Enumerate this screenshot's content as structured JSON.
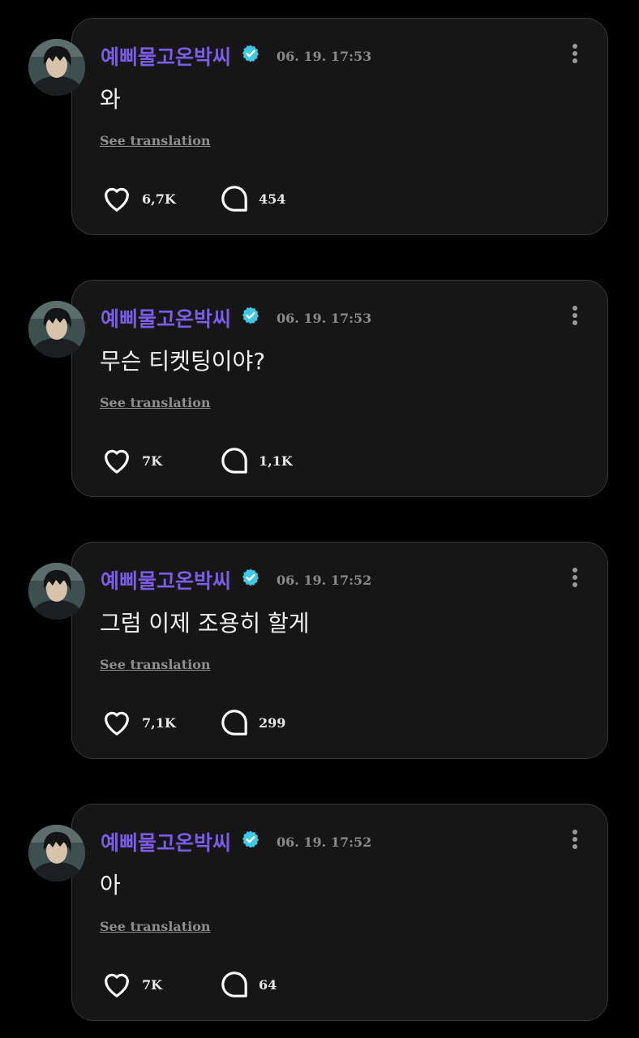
{
  "posts": [
    {
      "username": "예삐물고온박씨",
      "timestamp": "06. 19. 17:53",
      "message": "와",
      "translate_label": "See translation",
      "likes": "6,7K",
      "replies": "454"
    },
    {
      "username": "예삐물고온박씨",
      "timestamp": "06. 19. 17:53",
      "message": "무슨 티켓팅이야?",
      "translate_label": "See translation",
      "likes": "7K",
      "replies": "1,1K"
    },
    {
      "username": "예삐물고온박씨",
      "timestamp": "06. 19. 17:52",
      "message": "그럼 이제 조용히 할게",
      "translate_label": "See translation",
      "likes": "7,1K",
      "replies": "299"
    },
    {
      "username": "예삐물고온박씨",
      "timestamp": "06. 19. 17:52",
      "message": "아",
      "translate_label": "See translation",
      "likes": "7K",
      "replies": "64"
    }
  ],
  "colors": {
    "background": "#000000",
    "card": "#161616",
    "card_border": "#383838",
    "username": "#7b5ce6",
    "verified_badge": "#3ec8e6",
    "message": "#f2f2f2",
    "muted": "#8a8a8a"
  },
  "icons": [
    "verified-badge-icon",
    "more-vertical-icon",
    "heart-icon",
    "comment-bubble-icon"
  ]
}
